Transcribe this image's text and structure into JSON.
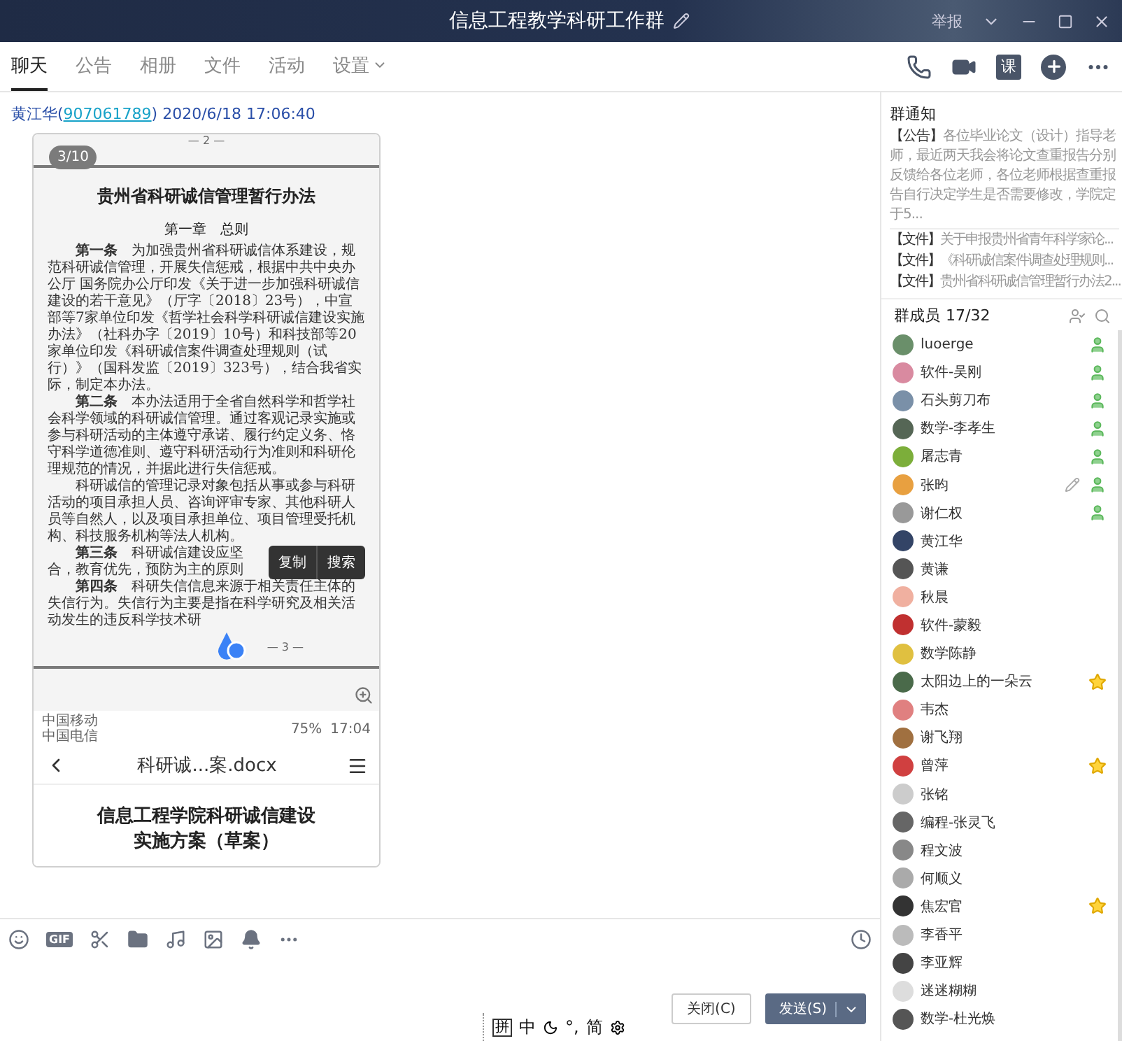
{
  "window": {
    "title": "信息工程教学科研工作群",
    "report": "举报"
  },
  "tabs": [
    {
      "label": "聊天",
      "selected": true,
      "dropdown": false
    },
    {
      "label": "公告",
      "selected": false,
      "dropdown": false
    },
    {
      "label": "相册",
      "selected": false,
      "dropdown": false
    },
    {
      "label": "文件",
      "selected": false,
      "dropdown": false
    },
    {
      "label": "活动",
      "selected": false,
      "dropdown": false
    },
    {
      "label": "设置",
      "selected": false,
      "dropdown": true
    }
  ],
  "header_actions": {
    "course": "课"
  },
  "message": {
    "sender": "黄江华",
    "brackets": [
      "(",
      ")"
    ],
    "qq": "907061789",
    "time": "2020/6/18 17:06:40",
    "image": {
      "page_counter": "3/10",
      "page_top": "— 2 —",
      "doc_title": "贵州省科研诚信管理暂行办法",
      "chapter": "第一章　总则",
      "paragraphs": [
        "**第一条**　为加强贵州省科研诚信体系建设，规范科研诚信管理，开展失信惩戒，根据中共中央办公厅 国务院办公厅印发《关于进一步加强科研诚信建设的若干意见》（厅字〔2018〕23号），中宣部等7家单位印发《哲学社会科学科研诚信建设实施办法》（社科办字〔2019〕10号）和科技部等20家单位印发《科研诚信案件调查处理规则（试行）》（国科发监〔2019〕323号），结合我省实际，制定本办法。",
        "**第二条**　本办法适用于全省自然科学和哲学社会科学领域的科研诚信管理。通过客观记录实施或参与科研活动的主体遵守承诺、履行约定义务、恪守科学道德准则、遵守科研活动行为准则和科研伦理规范的情况，并据此进行失信惩戒。",
        "科研诚信的管理记录对象包括从事或参与科研活动的项目承担人员、咨询评审专家、其他科研人员等自然人，以及项目承担单位、项目管理受托机构、科技服务机构等法人机构。"
      ],
      "covered_lines": [
        "**第三条**　科研诚信建设应坚",
        "合，教育优先，预防为主的原则"
      ],
      "popup": [
        "复制",
        "搜索"
      ],
      "last_paragraph": "**第四条**　科研失信信息来源于相关责任主体的失信行为。失信行为主要是指在科学研究及相关活动发生的违反科学技术研",
      "page_bottom": "— 3 —",
      "phone": {
        "carrier_1": "中国移动",
        "carrier_2": "中国电信",
        "battery": "75%",
        "time": "17:04",
        "file_title": "科研诚...案.docx",
        "heading": [
          "信息工程学院科研诚信建设",
          "实施方案（草案）"
        ]
      }
    }
  },
  "toolbar": {
    "gif": "GIF"
  },
  "buttons": [
    "关闭(C)",
    "发送(S)"
  ],
  "ime_bar": {
    "items": [
      "拼",
      "中",
      "°,",
      "简"
    ]
  },
  "notice": {
    "title": "群通知",
    "items": [
      {
        "tag": "【公告】",
        "text": "各位毕业论文（设计）指导老师，最近两天我会将论文查重报告分别反馈给各位老师，各位老师根据查重报告自行决定学生是否需要修改，学院定于5..."
      },
      {
        "tag": "【文件】",
        "text": "关于申报贵州省青年科学家论..."
      },
      {
        "tag": "【文件】",
        "text": "《科研诚信案件调查处理规则..."
      },
      {
        "tag": "【文件】",
        "text": "贵州省科研诚信管理暂行办法2..."
      }
    ]
  },
  "members": {
    "title": "群成员",
    "count": "17/32",
    "items": [
      {
        "name": "luoerge",
        "admin": true,
        "star": false,
        "edit": false
      },
      {
        "name": "软件-吴刚",
        "admin": true,
        "star": false,
        "edit": false
      },
      {
        "name": "石头剪刀布",
        "admin": true,
        "star": false,
        "edit": false
      },
      {
        "name": "数学-李孝生",
        "admin": true,
        "star": false,
        "edit": false
      },
      {
        "name": "屠志青",
        "admin": true,
        "star": false,
        "edit": false
      },
      {
        "name": "张昀",
        "admin": true,
        "star": false,
        "edit": true
      },
      {
        "name": "谢仁权",
        "admin": true,
        "star": false,
        "edit": false
      },
      {
        "name": "黄江华",
        "admin": false,
        "star": false,
        "edit": false
      },
      {
        "name": "黄谦",
        "admin": false,
        "star": false,
        "edit": false
      },
      {
        "name": "秋晨",
        "admin": false,
        "star": false,
        "edit": false
      },
      {
        "name": "软件-蒙毅",
        "admin": false,
        "star": false,
        "edit": false
      },
      {
        "name": "数学陈静",
        "admin": false,
        "star": false,
        "edit": false
      },
      {
        "name": "太阳边上的一朵云",
        "admin": false,
        "star": true,
        "edit": false
      },
      {
        "name": "韦杰",
        "admin": false,
        "star": false,
        "edit": false
      },
      {
        "name": "谢飞翔",
        "admin": false,
        "star": false,
        "edit": false
      },
      {
        "name": "曾萍",
        "admin": false,
        "star": true,
        "edit": false
      },
      {
        "name": "张铭",
        "admin": false,
        "star": false,
        "edit": false
      },
      {
        "name": "编程-张灵飞",
        "admin": false,
        "star": false,
        "edit": false
      },
      {
        "name": "程文波",
        "admin": false,
        "star": false,
        "edit": false
      },
      {
        "name": "何顺义",
        "admin": false,
        "star": false,
        "edit": false
      },
      {
        "name": "焦宏官",
        "admin": false,
        "star": true,
        "edit": false
      },
      {
        "name": "李香平",
        "admin": false,
        "star": false,
        "edit": false
      },
      {
        "name": "李亚辉",
        "admin": false,
        "star": false,
        "edit": false
      },
      {
        "name": "迷迷糊糊",
        "admin": false,
        "star": false,
        "edit": false
      },
      {
        "name": "数学-杜光焕",
        "admin": false,
        "star": false,
        "edit": false
      }
    ]
  }
}
